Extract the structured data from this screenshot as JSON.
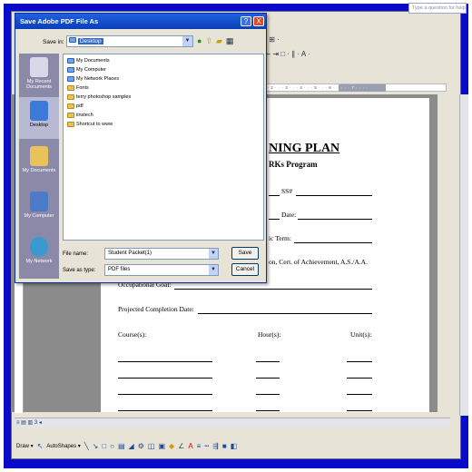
{
  "word": {
    "ask_box": "Type a question for help",
    "toolbar_row1": "% · ⊞ ·",
    "toolbar_row2": "☰ ⇤ ⇥ □ · ∥ · A ·",
    "ruler_text": "· · · 2 · · · 3 · · · 4 · · · 5 · · · 6 ·",
    "ruler_sel": "· · · 7 · · · ·",
    "tab_status": "≡ ▤ ▥ 3 ◂",
    "draw_label": "Draw ▾",
    "autoshapes_label": "AutoShapes ▾"
  },
  "document": {
    "title": "NING PLAN",
    "subtitle": "RKs Program",
    "ss_label": "SS#",
    "date_label": "Date:",
    "term_label": "ic Term:",
    "degree_line": "on, Cert. of Achievement, A.S./A.A.",
    "occ_goal": "Occupational Goal:",
    "projected_label": "Projected Completion Date:",
    "col_courses": "Course(s):",
    "col_hours": "Hour(s):",
    "col_units": "Unit(s):"
  },
  "dialog": {
    "title": "Save Adobe PDF File As",
    "help_btn": "?",
    "close_btn": "X",
    "save_in_label": "Save in:",
    "save_in_value": "Desktop",
    "places": [
      {
        "label": "My Recent Documents",
        "color": "#d8d8e8"
      },
      {
        "label": "Desktop",
        "color": "#3a7ad8"
      },
      {
        "label": "My Documents",
        "color": "#e8c25a"
      },
      {
        "label": "My Computer",
        "color": "#4a7ac8"
      },
      {
        "label": "My Network",
        "color": "#3a9ad0"
      }
    ],
    "files": [
      {
        "name": "My Documents",
        "type": "blue"
      },
      {
        "name": "My Computer",
        "type": "blue"
      },
      {
        "name": "My Network Places",
        "type": "blue"
      },
      {
        "name": "Fonts",
        "type": "yellow"
      },
      {
        "name": "terry photoshop samples",
        "type": "yellow"
      },
      {
        "name": "pdf",
        "type": "yellow"
      },
      {
        "name": "iinstech",
        "type": "yellow"
      },
      {
        "name": "Shortcut to www",
        "type": "yellow"
      }
    ],
    "filename_label": "File name:",
    "filename_value": "Student Packet(1)",
    "savetype_label": "Save as type:",
    "savetype_value": "PDF files",
    "save_btn": "Save",
    "cancel_btn": "Cancel"
  }
}
